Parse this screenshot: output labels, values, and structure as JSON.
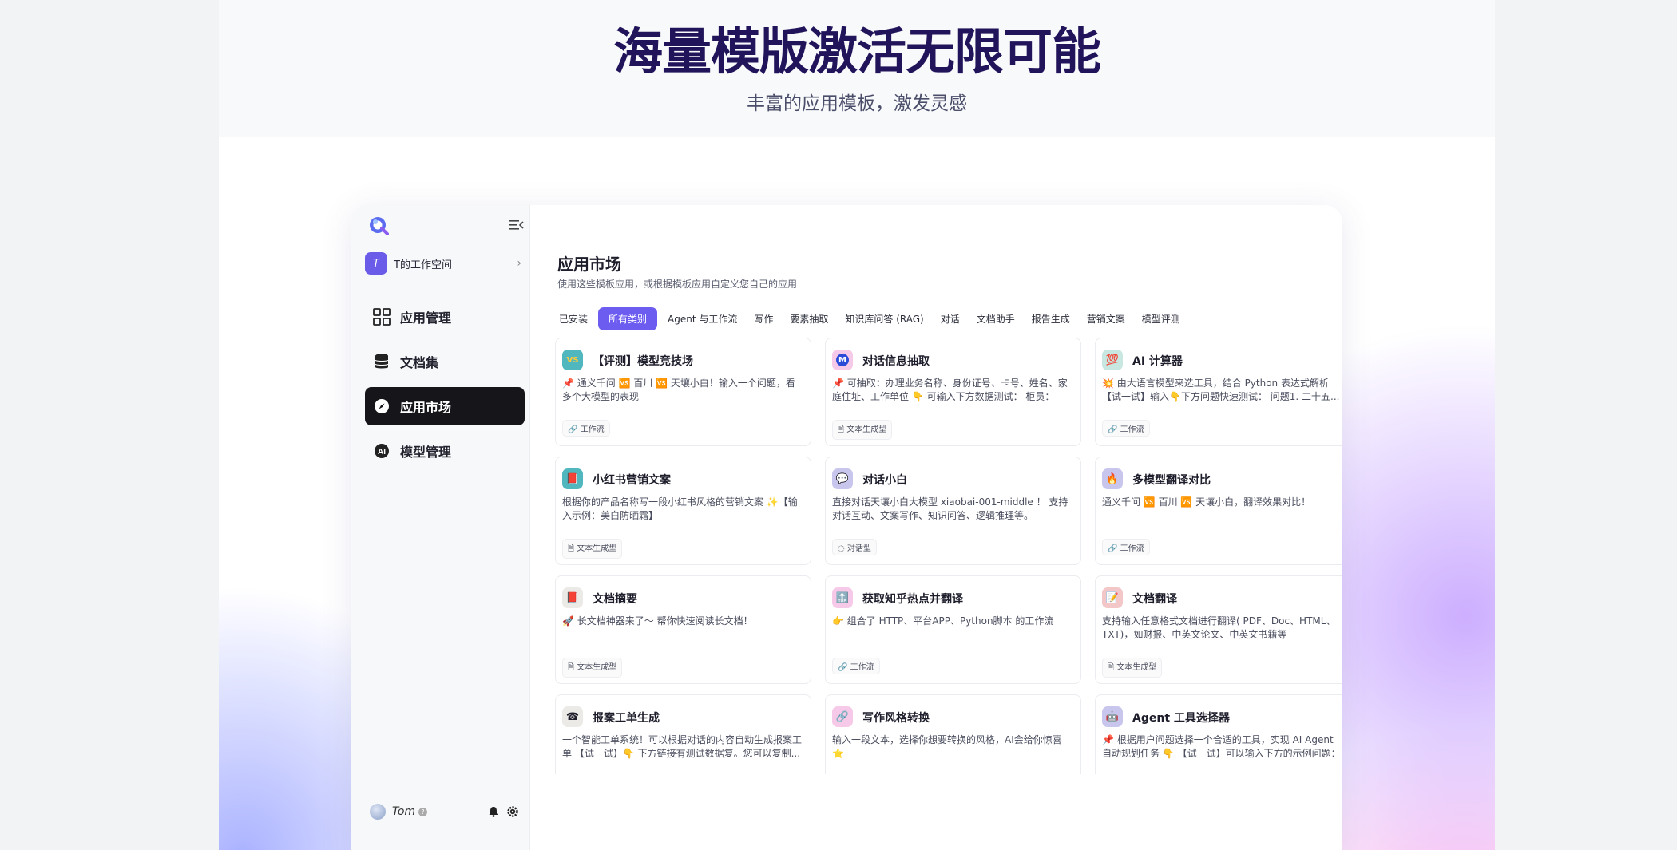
{
  "hero": {
    "title": "海量模版激活无限可能",
    "subtitle": "丰富的应用模板，激发灵感"
  },
  "sidebar": {
    "workspace": {
      "avatar_letter": "T",
      "name": "T的工作空间"
    },
    "items": [
      {
        "label": "应用管理",
        "icon": "grid-icon"
      },
      {
        "label": "文档集",
        "icon": "database-icon"
      },
      {
        "label": "应用市场",
        "icon": "compass-icon",
        "active": true
      },
      {
        "label": "模型管理",
        "icon": "ai-icon"
      }
    ],
    "user": {
      "name": "Tom",
      "badge": "?"
    }
  },
  "main": {
    "title": "应用市场",
    "subtitle": "使用这些模板应用，或根据模板应用自定义您自己的应用",
    "tabs": [
      {
        "label": "已安装"
      },
      {
        "label": "所有类别",
        "active": true
      },
      {
        "label": "Agent 与工作流"
      },
      {
        "label": "写作"
      },
      {
        "label": "要素抽取"
      },
      {
        "label": "知识库问答 (RAG)"
      },
      {
        "label": "对话"
      },
      {
        "label": "文档助手"
      },
      {
        "label": "报告生成"
      },
      {
        "label": "营销文案"
      },
      {
        "label": "模型评测"
      }
    ],
    "cards": [
      {
        "title": "【评测】模型竞技场",
        "desc": "📌 通义千问 🆚 百川 🆚 天壤小白！输入一个问题，看多个大模型的表现",
        "tag": "工作流",
        "icon_glyph": "VS",
        "icon_bg": "#4fb7bd"
      },
      {
        "title": "对话信息抽取",
        "desc": "📌 可抽取：办理业务名称、身份证号、卡号、姓名、家庭住址、工作单位 👇 可输入下方数据测试： 柜员：很...",
        "tag": "文本生成型",
        "icon_glyph": "M",
        "icon_bg": "#f7c9e8"
      },
      {
        "title": "AI 计算器",
        "desc": "💥 由大语言模型来选工具，结合 Python 表达式解析【试一试】输入👇下方问题快速测试： 问题1. 二十五...",
        "tag": "工作流",
        "icon_glyph": "💯",
        "icon_bg": "#c7e7e0"
      },
      {
        "title": "小红书营销文案",
        "desc": "根据你的产品名称写一段小红书风格的营销文案 ✨【输入示例：美白防晒霜】",
        "tag": "文本生成型",
        "icon_glyph": "📕",
        "icon_bg": "#4fb7bd"
      },
      {
        "title": "对话小白",
        "desc": "直接对话天壤小白大模型 xiaobai-001-middle ！ 支持对话互动、文案写作、知识问答、逻辑推理等。",
        "tag": "对话型",
        "icon_glyph": "💬",
        "icon_bg": "#c9c6ee"
      },
      {
        "title": "多模型翻译对比",
        "desc": "通义千问 🆚 百川 🆚 天壤小白，翻译效果对比！",
        "tag": "工作流",
        "icon_glyph": "🔥",
        "icon_bg": "#c9c6ee"
      },
      {
        "title": "文档摘要",
        "desc": "🚀 长文档神器来了～ 帮你快速阅读长文档！",
        "tag": "文本生成型",
        "icon_glyph": "📕",
        "icon_bg": "#eceae6"
      },
      {
        "title": "获取知乎热点并翻译",
        "desc": "👉 组合了 HTTP、平台APP、Python脚本 的工作流",
        "tag": "工作流",
        "icon_glyph": "🔝",
        "icon_bg": "#f7c9e8"
      },
      {
        "title": "文档翻译",
        "desc": "支持输入任意格式文档进行翻译( PDF、Doc、HTML、TXT)，如财报、中英文论文、中英文书籍等",
        "tag": "文本生成型",
        "icon_glyph": "📝",
        "icon_bg": "#f3c7c7"
      },
      {
        "title": "报案工单生成",
        "desc": "一个智能工单系统！可以根据对话的内容自动生成报案工单 【试一试】👇 下方链接有测试数据复。您可以复制...",
        "tag": "",
        "icon_glyph": "☎",
        "icon_bg": "#eceae6"
      },
      {
        "title": "写作风格转换",
        "desc": "输入一段文本，选择你想要转换的风格，AI会给你惊喜 ⭐",
        "tag": "",
        "icon_glyph": "🔗",
        "icon_bg": "#f7c9e8"
      },
      {
        "title": "Agent 工具选择器",
        "desc": "📌 根据用户问题选择一个合适的工具，实现 AI Agent 自动规划任务 👇 【试一试】可以输入下方的示例问题： ...",
        "tag": "",
        "icon_glyph": "🤖",
        "icon_bg": "#c9c6ee"
      }
    ]
  }
}
